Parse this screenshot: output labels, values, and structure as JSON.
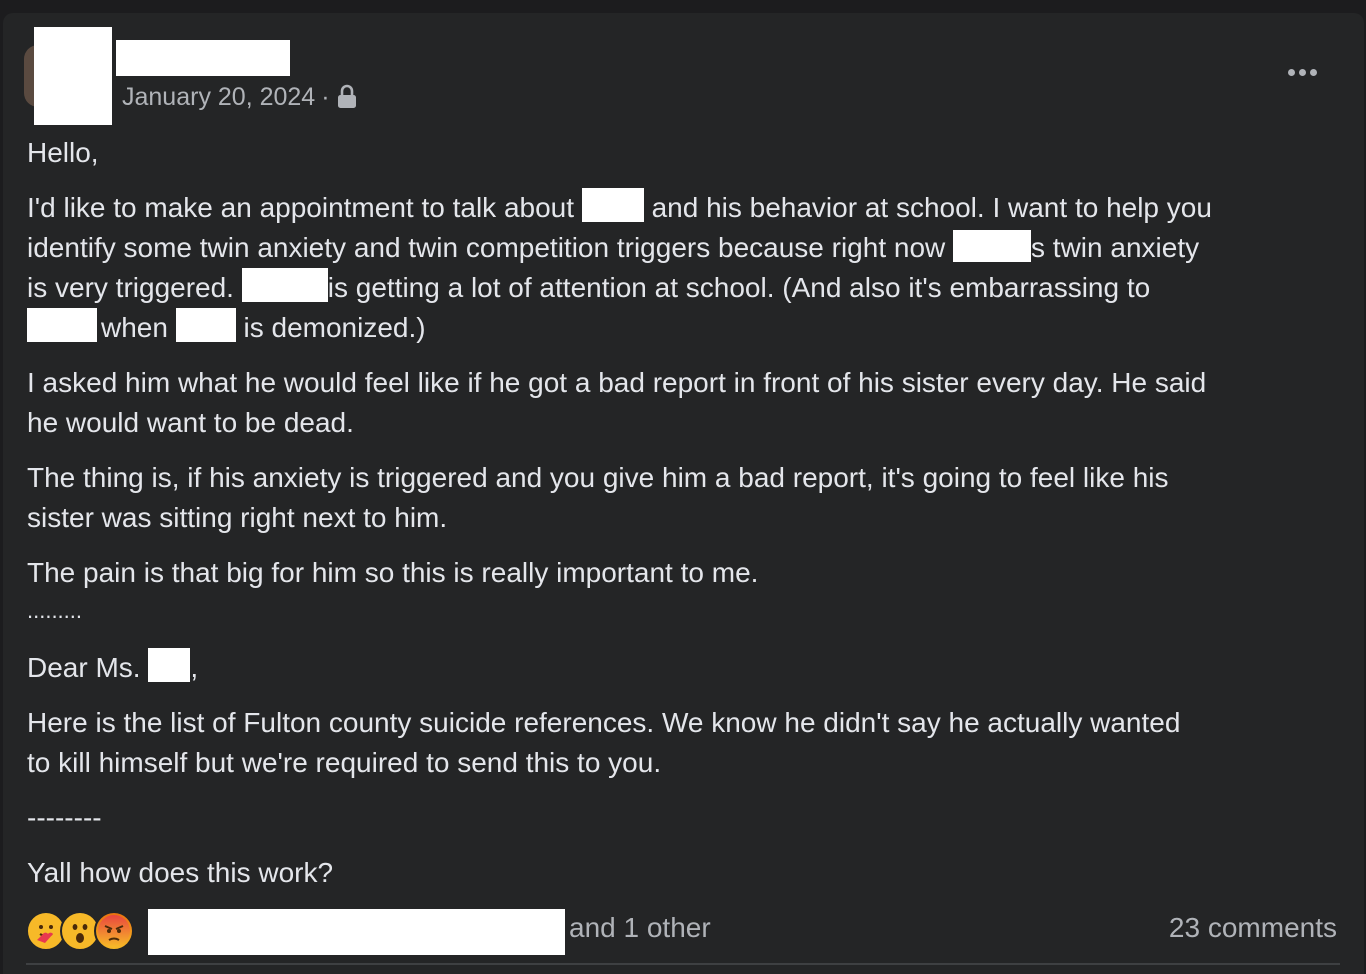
{
  "post": {
    "date": "January 20, 2024",
    "separator": "·",
    "privacy_icon": "lock-icon",
    "more_icon": "more-horizontal-icon"
  },
  "body": {
    "greeting": "Hello,",
    "p1": {
      "a": "I'd like to make an appointment to talk about ",
      "b": " and his behavior at school.  I want to help you",
      "c": "identify some twin anxiety and twin competition triggers because right now ",
      "d": "s twin anxiety",
      "e": "is very triggered.  ",
      "f": "is getting a lot of attention at school.  (And also it's embarrassing to",
      "g": "when ",
      "h": " is demonized.)"
    },
    "p2_line1": "I asked him what he would feel like if he got a bad report in front of his sister every day.  He said",
    "p2_line2": "he would want to be dead.",
    "p3_line1": "The thing is, if his anxiety is triggered and you give him a bad report, it's going to feel like his",
    "p3_line2": "sister was sitting right next to him.",
    "p4": "The pain is that big for him so this is really important to me.",
    "dots": ".........",
    "dear_a": "Dear Ms. ",
    "dear_b": ",",
    "p5_line1": "Here is the list of Fulton county suicide references.  We know he didn't say he actually wanted",
    "p5_line2": "to kill himself but we're required to send this to you.",
    "dashes": "--------",
    "question": "Yall how does this work?"
  },
  "footer": {
    "reactions": [
      "care-emoji",
      "wow-emoji",
      "angry-emoji"
    ],
    "and_other": "and 1 other",
    "comments": "23 comments"
  },
  "colors": {
    "background": "#242526",
    "text": "#e4e6eb",
    "secondary_text": "#b0b3b8"
  }
}
